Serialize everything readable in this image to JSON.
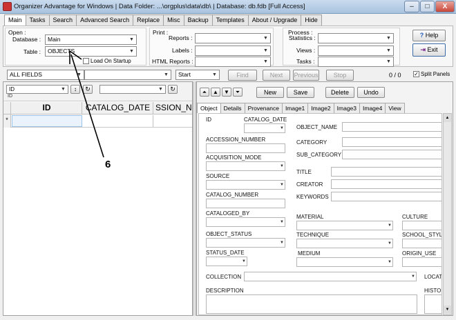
{
  "window": {
    "title": "Organizer Advantage for Windows | Data Folder: ...\\orgplus\\data\\db\\ | Database: db.fdb [Full Access]",
    "minimize": "–",
    "maximize": "□",
    "close": "X"
  },
  "menu_tabs": [
    "Main",
    "Tasks",
    "Search",
    "Advanced Search",
    "Replace",
    "Misc",
    "Backup",
    "Templates",
    "About / Upgrade",
    "Hide"
  ],
  "open_group": {
    "title": "Open :",
    "database_label": "Database :",
    "database_value": "Main",
    "table_label": "Table :",
    "table_value": "OBJECTS",
    "load_on_startup": "Load On Startup"
  },
  "print_group": {
    "title": "Print :",
    "reports_label": "Reports :",
    "labels_label": "Labels :",
    "html_reports_label": "HTML Reports :"
  },
  "process_group": {
    "title": "Process :",
    "statistics_label": "Statistics :",
    "views_label": "Views :",
    "tasks_label": "Tasks :"
  },
  "help_button": "Help",
  "exit_button": "Exit",
  "search_bar": {
    "field_select": "ALL FIELDS",
    "start_select": "Start",
    "find": "Find",
    "next": "Next",
    "previous": "Previous",
    "stop": "Stop",
    "count": "0 / 0",
    "split_panels": "Split Panels"
  },
  "grid": {
    "sort_field": "ID",
    "sort_sub": "ID",
    "columns": [
      "ID",
      "CATALOG_DATE",
      "SSION_NU"
    ],
    "row_marker": "*"
  },
  "record_buttons": {
    "new": "New",
    "save": "Save",
    "delete": "Delete",
    "undo": "Undo"
  },
  "detail_tabs": [
    "Object",
    "Details",
    "Provenance",
    "Image1",
    "Image2",
    "Image3",
    "Image4",
    "View"
  ],
  "form_labels": {
    "id": "ID",
    "catalog_date": "CATALOG_DATE",
    "object_name": "OBJECT_NAME",
    "accession_number": "ACCESSION_NUMBER",
    "category": "CATEGORY",
    "acquisition_mode": "ACQUISITION_MODE",
    "sub_category": "SUB_CATEGORY",
    "source": "SOURCE",
    "title": "TITLE",
    "creator": "CREATOR",
    "catalog_number": "CATALOG_NUMBER",
    "keywords": "KEYWORDS",
    "cataloged_by": "CATALOGED_BY",
    "material": "MATERIAL",
    "culture": "CULTURE",
    "object_status": "OBJECT_STATUS",
    "technique": "TECHNIQUE",
    "school_style": "SCHOOL_STYL",
    "status_date": "STATUS_DATE",
    "medium": "MEDIUM",
    "origin_use": "ORIGIN_USE",
    "collection": "COLLECTION",
    "location": "LOCAT",
    "description": "DESCRIPTION",
    "history": "HISTO"
  },
  "annotation": {
    "callout_number": "6"
  }
}
